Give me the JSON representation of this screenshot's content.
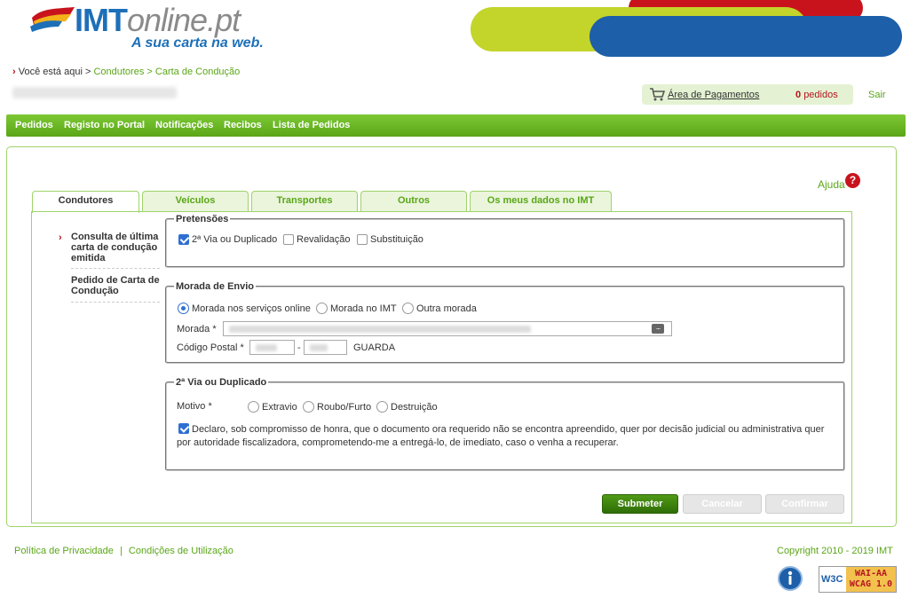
{
  "header": {
    "logo_brand": "IMT",
    "logo_suffix": "online.pt",
    "tagline": "A sua carta na web."
  },
  "breadcrumb": {
    "prefix": "Você está aqui >",
    "items": [
      "Condutores",
      ">",
      "Carta de Condução"
    ]
  },
  "account": {
    "payments_label": "Área de Pagamentos",
    "orders_count": "0",
    "orders_label": "pedidos",
    "logout_label": "Sair"
  },
  "nav": {
    "items": [
      "Pedidos",
      "Registo no Portal",
      "Notificações",
      "Recibos",
      "Lista de Pedidos"
    ]
  },
  "help_label": "Ajuda",
  "tabs": [
    "Condutores",
    "Veículos",
    "Transportes",
    "Outros",
    "Os meus dados no IMT"
  ],
  "active_tab": "Condutores",
  "side_menu": [
    "Consulta de última carta de condução emitida",
    "Pedido de Carta de Condução"
  ],
  "pretensoes": {
    "legend": "Pretensões",
    "options": [
      {
        "label": "2ª Via ou Duplicado",
        "checked": true
      },
      {
        "label": "Revalidação",
        "checked": false
      },
      {
        "label": "Substituição",
        "checked": false
      }
    ]
  },
  "morada_envio": {
    "legend": "Morada de Envio",
    "options": [
      {
        "label": "Morada nos serviços online",
        "selected": true
      },
      {
        "label": "Morada no IMT",
        "selected": false
      },
      {
        "label": "Outra morada",
        "selected": false
      }
    ],
    "morada_label": "Morada *",
    "codigo_postal_label": "Código Postal *",
    "postal_separator": "-",
    "locality": "GUARDA"
  },
  "segunda_via": {
    "legend": "2ª Via ou Duplicado",
    "motivo_label": "Motivo *",
    "motivos": [
      {
        "label": "Extravio",
        "selected": false
      },
      {
        "label": "Roubo/Furto",
        "selected": false
      },
      {
        "label": "Destruição",
        "selected": false
      }
    ],
    "declaration_checked": true,
    "declaration": "Declaro, sob compromisso de honra, que o documento ora requerido não se encontra apreendido, quer por decisão judicial ou administrativa quer por autoridade fiscalizadora, comprometendo-me a entregá-lo, de imediato, caso o venha a recuperar."
  },
  "buttons": {
    "submit": "Submeter",
    "cancel": "Cancelar",
    "confirm": "Confirmar"
  },
  "footer": {
    "privacy": "Política de Privacidade",
    "separator": "|",
    "terms": "Condições de Utilização",
    "copyright": "Copyright 2010 - 2019 IMT",
    "badge_top": "WAI-AA",
    "badge_bottom": "WCAG 1.0",
    "w3c": "W3C"
  },
  "colors": {
    "brand_green": "#5aa617",
    "brand_blue": "#1d6fb8",
    "accent_red": "#b5151f",
    "check_blue": "#2f6fd1"
  }
}
